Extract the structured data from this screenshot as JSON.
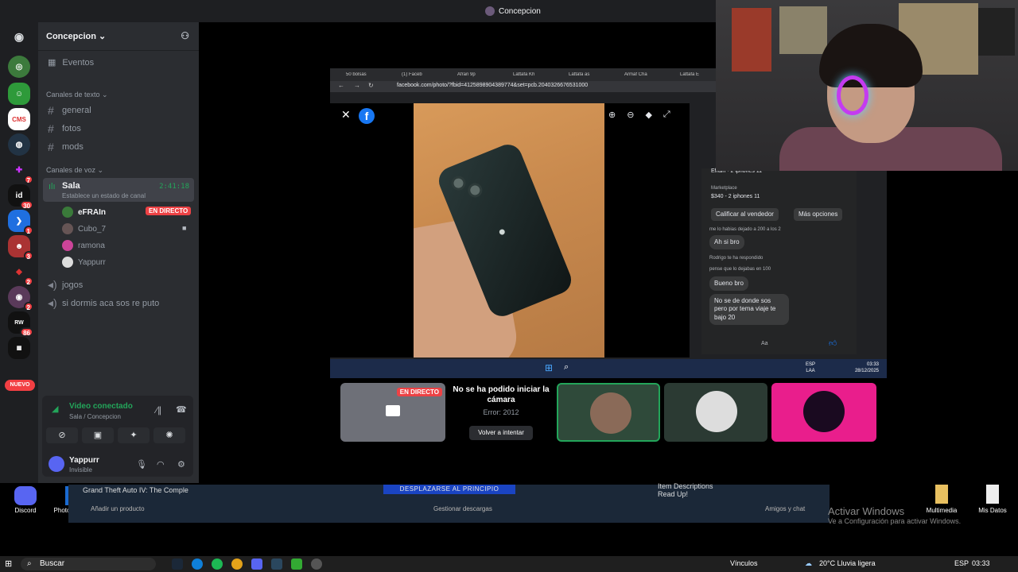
{
  "window": {
    "title": "Concepcion"
  },
  "server": {
    "name": "Concepcion",
    "events_label": "Eventos",
    "text_category": "Canales de texto",
    "text_channels": [
      "general",
      "fotos",
      "mods"
    ],
    "voice_category": "Canales de voz",
    "voice_channel": {
      "name": "Sala",
      "status": "Establece un estado de canal",
      "timer": "2:41:18"
    },
    "members": [
      {
        "name": "eFRAIn",
        "live": "EN DIRECTO",
        "color": "#f2f3f5"
      },
      {
        "name": "Cubo_7",
        "color": "#949ba4"
      },
      {
        "name": "ramona",
        "color": "#949ba4"
      },
      {
        "name": "Yappurr",
        "color": "#949ba4"
      }
    ],
    "other_voice": [
      "jogos",
      "si dormis aca sos re puto"
    ]
  },
  "rail": {
    "badges": [
      "7",
      "30",
      "1",
      "3",
      "2",
      "2",
      "86"
    ],
    "new_label": "NUEVO"
  },
  "voice_panel": {
    "title": "Video conectado",
    "subtitle": "Sala / Concepcion"
  },
  "user": {
    "name": "Yappurr",
    "status": "Invisible"
  },
  "browser": {
    "tabs": [
      "50 bolsas",
      "(1) Faceb",
      "Afran 9p",
      "Lattafa Kh",
      "Lattafa as",
      "Armaf Cha",
      "Lattafa E"
    ],
    "url": "facebook.com/photo/?fbid=4125898904389774&set=pcb.2040326676531000"
  },
  "chat": {
    "header": "Efrain · 2 iphones 11",
    "marketplace": "Marketplace",
    "listing": "$340 - 2 iphones 11",
    "btn1": "Calificar al vendedor",
    "btn2": "Más opciones",
    "reply1": "me lo habias dejado a 200 a los 2",
    "msg1": "Ah si bro",
    "replied": "Rodrigo te ha respondido",
    "reply2": "pense que lo dejabas en 100",
    "msg2": "Bueno bro",
    "msg3": "No se de donde sos pero por tema viaje te bajo 20",
    "input": "Aa"
  },
  "inner_taskbar": {
    "lang1": "ESP",
    "lang2": "LAA",
    "time": "03:33",
    "date": "28/12/2025"
  },
  "tiles": {
    "live": "EN DIRECTO",
    "error_title": "No se ha podido iniciar la cámara",
    "error_code": "Error: 2012",
    "retry": "Volver a intentar"
  },
  "desktop": {
    "discord": "Discord",
    "photo": "Photo",
    "multimedia": "Multimedia",
    "misdatos": "Mis Datos"
  },
  "steam": {
    "game": "Grand Theft Auto IV: The Comple",
    "scroll_top": "DESPLAZARSE AL PRINCIPIO",
    "item": "Item Descriptions",
    "item2": "Read Up!",
    "add_product": "Añadir un producto",
    "downloads": "Gestionar descargas",
    "friends": "Amigos y chat"
  },
  "activation": {
    "line1": "Activar Windows",
    "line2": "Ve a Configuración para activar Windows."
  },
  "taskbar": {
    "search": "Buscar",
    "links": "Vínculos",
    "weather": "20°C  Lluvia ligera",
    "lang": "ESP",
    "time": "03:33"
  }
}
